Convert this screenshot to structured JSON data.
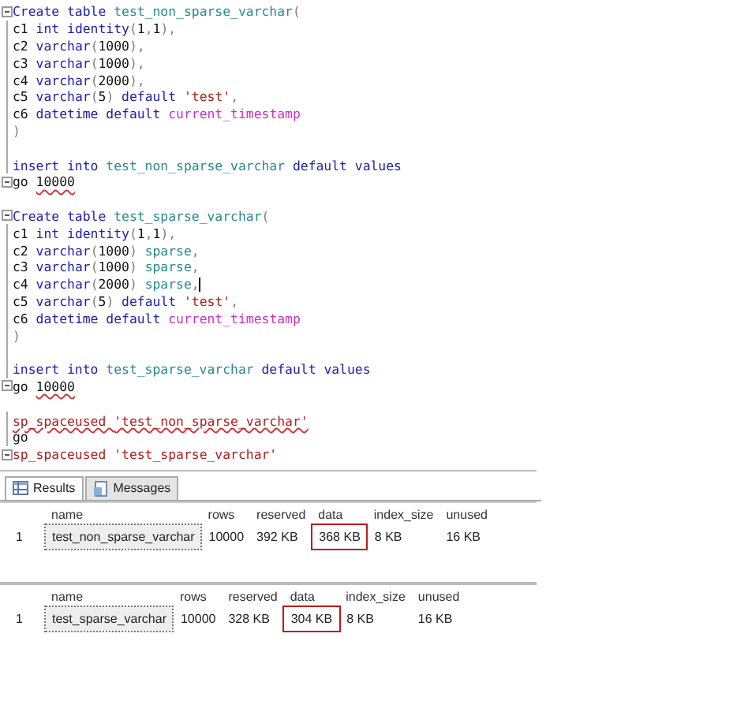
{
  "editor": {
    "lines": [
      {
        "kind": "fold_start",
        "tokens": [
          {
            "kind": "keyword",
            "t": "Create table "
          },
          {
            "kind": "object",
            "t": "test_non_sparse_varchar"
          },
          {
            "kind": "operator",
            "t": "("
          }
        ]
      },
      {
        "kind": "fold_body",
        "tokens": [
          {
            "kind": "text",
            "t": "c1 "
          },
          {
            "kind": "keyword",
            "t": "int identity"
          },
          {
            "kind": "operator",
            "t": "("
          },
          {
            "kind": "text",
            "t": "1"
          },
          {
            "kind": "operator",
            "t": ","
          },
          {
            "kind": "text",
            "t": "1"
          },
          {
            "kind": "operator",
            "t": "),"
          }
        ]
      },
      {
        "kind": "fold_body",
        "tokens": [
          {
            "kind": "text",
            "t": "c2 "
          },
          {
            "kind": "keyword",
            "t": "varchar"
          },
          {
            "kind": "operator",
            "t": "("
          },
          {
            "kind": "text",
            "t": "1000"
          },
          {
            "kind": "operator",
            "t": "),"
          }
        ]
      },
      {
        "kind": "fold_body",
        "tokens": [
          {
            "kind": "text",
            "t": "c3 "
          },
          {
            "kind": "keyword",
            "t": "varchar"
          },
          {
            "kind": "operator",
            "t": "("
          },
          {
            "kind": "text",
            "t": "1000"
          },
          {
            "kind": "operator",
            "t": "),"
          }
        ]
      },
      {
        "kind": "fold_body",
        "tokens": [
          {
            "kind": "text",
            "t": "c4 "
          },
          {
            "kind": "keyword",
            "t": "varchar"
          },
          {
            "kind": "operator",
            "t": "("
          },
          {
            "kind": "text",
            "t": "2000"
          },
          {
            "kind": "operator",
            "t": "),"
          }
        ]
      },
      {
        "kind": "fold_body",
        "tokens": [
          {
            "kind": "text",
            "t": "c5 "
          },
          {
            "kind": "keyword",
            "t": "varchar"
          },
          {
            "kind": "operator",
            "t": "("
          },
          {
            "kind": "text",
            "t": "5"
          },
          {
            "kind": "operator",
            "t": ") "
          },
          {
            "kind": "keyword",
            "t": "default "
          },
          {
            "kind": "string",
            "t": "'test'"
          },
          {
            "kind": "operator",
            "t": ","
          }
        ]
      },
      {
        "kind": "fold_body",
        "tokens": [
          {
            "kind": "text",
            "t": "c6 "
          },
          {
            "kind": "keyword",
            "t": "datetime default "
          },
          {
            "kind": "function",
            "t": "current_timestamp"
          }
        ]
      },
      {
        "kind": "fold_body",
        "tokens": [
          {
            "kind": "operator",
            "t": ")"
          }
        ]
      },
      {
        "kind": "fold_body"
      },
      {
        "kind": "fold_body",
        "tokens": [
          {
            "kind": "keyword",
            "t": "insert into "
          },
          {
            "kind": "object",
            "t": "test_non_sparse_varchar"
          },
          {
            "kind": "keyword",
            "t": " default values"
          }
        ]
      },
      {
        "kind": "fold_start",
        "tokens": [
          {
            "kind": "text",
            "t": "go "
          },
          {
            "kind": "text",
            "t": "10000",
            "squiggle": true
          }
        ]
      },
      {
        "kind": "plain"
      },
      {
        "kind": "fold_start",
        "tokens": [
          {
            "kind": "keyword",
            "t": "Create table "
          },
          {
            "kind": "object",
            "t": "test_sparse_varchar"
          },
          {
            "kind": "operator",
            "t": "("
          }
        ]
      },
      {
        "kind": "fold_body",
        "tokens": [
          {
            "kind": "text",
            "t": "c1 "
          },
          {
            "kind": "keyword",
            "t": "int identity"
          },
          {
            "kind": "operator",
            "t": "("
          },
          {
            "kind": "text",
            "t": "1"
          },
          {
            "kind": "operator",
            "t": ","
          },
          {
            "kind": "text",
            "t": "1"
          },
          {
            "kind": "operator",
            "t": "),"
          }
        ]
      },
      {
        "kind": "fold_body",
        "tokens": [
          {
            "kind": "text",
            "t": "c2 "
          },
          {
            "kind": "keyword",
            "t": "varchar"
          },
          {
            "kind": "operator",
            "t": "("
          },
          {
            "kind": "text",
            "t": "1000"
          },
          {
            "kind": "operator",
            "t": ") "
          },
          {
            "kind": "object",
            "t": "sparse"
          },
          {
            "kind": "operator",
            "t": ","
          }
        ]
      },
      {
        "kind": "fold_body",
        "tokens": [
          {
            "kind": "text",
            "t": "c3 "
          },
          {
            "kind": "keyword",
            "t": "varchar"
          },
          {
            "kind": "operator",
            "t": "("
          },
          {
            "kind": "text",
            "t": "1000"
          },
          {
            "kind": "operator",
            "t": ") "
          },
          {
            "kind": "object",
            "t": "sparse"
          },
          {
            "kind": "operator",
            "t": ","
          }
        ]
      },
      {
        "kind": "fold_body",
        "cursor": true,
        "tokens": [
          {
            "kind": "text",
            "t": "c4 "
          },
          {
            "kind": "keyword",
            "t": "varchar"
          },
          {
            "kind": "operator",
            "t": "("
          },
          {
            "kind": "text",
            "t": "2000"
          },
          {
            "kind": "operator",
            "t": ") "
          },
          {
            "kind": "object",
            "t": "sparse"
          },
          {
            "kind": "operator",
            "t": ","
          }
        ]
      },
      {
        "kind": "fold_body",
        "tokens": [
          {
            "kind": "text",
            "t": "c5 "
          },
          {
            "kind": "keyword",
            "t": "varchar"
          },
          {
            "kind": "operator",
            "t": "("
          },
          {
            "kind": "text",
            "t": "5"
          },
          {
            "kind": "operator",
            "t": ") "
          },
          {
            "kind": "keyword",
            "t": "default "
          },
          {
            "kind": "string",
            "t": "'test'"
          },
          {
            "kind": "operator",
            "t": ","
          }
        ]
      },
      {
        "kind": "fold_body",
        "tokens": [
          {
            "kind": "text",
            "t": "c6 "
          },
          {
            "kind": "keyword",
            "t": "datetime default "
          },
          {
            "kind": "function",
            "t": "current_timestamp"
          }
        ]
      },
      {
        "kind": "fold_body",
        "tokens": [
          {
            "kind": "operator",
            "t": ")"
          }
        ]
      },
      {
        "kind": "fold_body"
      },
      {
        "kind": "fold_body",
        "tokens": [
          {
            "kind": "keyword",
            "t": "insert into "
          },
          {
            "kind": "object",
            "t": "test_sparse_varchar"
          },
          {
            "kind": "keyword",
            "t": " default values"
          }
        ]
      },
      {
        "kind": "fold_start",
        "tokens": [
          {
            "kind": "text",
            "t": "go "
          },
          {
            "kind": "text",
            "t": "10000",
            "squiggle": true
          }
        ]
      },
      {
        "kind": "plain"
      },
      {
        "kind": "fold_body",
        "tokens": [
          {
            "kind": "string",
            "t": "sp_spaceused ",
            "squiggle": true
          },
          {
            "kind": "string",
            "t": "'test_non_sparse_varchar'",
            "squiggle": true
          }
        ]
      },
      {
        "kind": "fold_body",
        "tokens": [
          {
            "kind": "text",
            "t": "go"
          }
        ]
      },
      {
        "kind": "fold_start",
        "tokens": [
          {
            "kind": "string",
            "t": "sp_spaceused "
          },
          {
            "kind": "string",
            "t": "'test_sparse_varchar'"
          }
        ]
      }
    ]
  },
  "tabs": [
    {
      "label": "Results",
      "selected": true
    },
    {
      "label": "Messages",
      "selected": false
    }
  ],
  "grids": [
    {
      "columns": [
        "name",
        "rows",
        "reserved",
        "data",
        "index_size",
        "unused"
      ],
      "rows": [
        {
          "number": "1",
          "cells": [
            {
              "t": "test_non_sparse_varchar",
              "selected": true,
              "circled": false
            },
            {
              "t": "10000",
              "selected": false,
              "circled": false
            },
            {
              "t": "392 KB",
              "selected": false,
              "circled": false
            },
            {
              "t": "368 KB",
              "selected": false,
              "circled": true
            },
            {
              "t": "8 KB",
              "selected": false,
              "circled": false
            },
            {
              "t": "16 KB",
              "selected": false,
              "circled": false
            }
          ]
        }
      ]
    },
    {
      "columns": [
        "name",
        "rows",
        "reserved",
        "data",
        "index_size",
        "unused"
      ],
      "rows": [
        {
          "number": "1",
          "cells": [
            {
              "t": "test_sparse_varchar",
              "selected": true,
              "circled": false
            },
            {
              "t": "10000",
              "selected": false,
              "circled": false
            },
            {
              "t": "328 KB",
              "selected": false,
              "circled": false
            },
            {
              "t": "304 KB",
              "selected": false,
              "circled": true
            },
            {
              "t": "8 KB",
              "selected": false,
              "circled": false
            },
            {
              "t": "16 KB",
              "selected": false,
              "circled": false
            }
          ]
        }
      ]
    }
  ]
}
